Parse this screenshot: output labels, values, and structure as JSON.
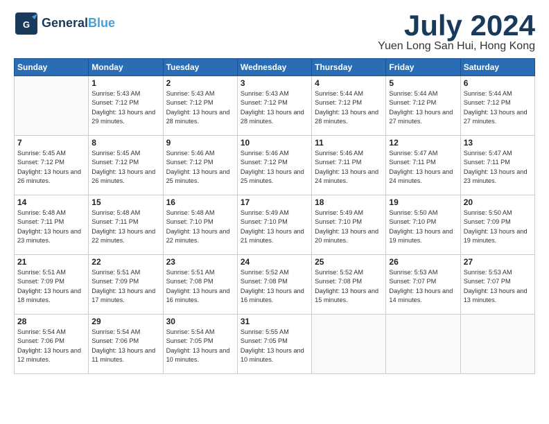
{
  "header": {
    "logo_general": "General",
    "logo_blue": "Blue",
    "month": "July 2024",
    "location": "Yuen Long San Hui, Hong Kong"
  },
  "weekdays": [
    "Sunday",
    "Monday",
    "Tuesday",
    "Wednesday",
    "Thursday",
    "Friday",
    "Saturday"
  ],
  "weeks": [
    [
      {
        "day": "",
        "sunrise": "",
        "sunset": "",
        "daylight": ""
      },
      {
        "day": "1",
        "sunrise": "Sunrise: 5:43 AM",
        "sunset": "Sunset: 7:12 PM",
        "daylight": "Daylight: 13 hours and 29 minutes."
      },
      {
        "day": "2",
        "sunrise": "Sunrise: 5:43 AM",
        "sunset": "Sunset: 7:12 PM",
        "daylight": "Daylight: 13 hours and 28 minutes."
      },
      {
        "day": "3",
        "sunrise": "Sunrise: 5:43 AM",
        "sunset": "Sunset: 7:12 PM",
        "daylight": "Daylight: 13 hours and 28 minutes."
      },
      {
        "day": "4",
        "sunrise": "Sunrise: 5:44 AM",
        "sunset": "Sunset: 7:12 PM",
        "daylight": "Daylight: 13 hours and 28 minutes."
      },
      {
        "day": "5",
        "sunrise": "Sunrise: 5:44 AM",
        "sunset": "Sunset: 7:12 PM",
        "daylight": "Daylight: 13 hours and 27 minutes."
      },
      {
        "day": "6",
        "sunrise": "Sunrise: 5:44 AM",
        "sunset": "Sunset: 7:12 PM",
        "daylight": "Daylight: 13 hours and 27 minutes."
      }
    ],
    [
      {
        "day": "7",
        "sunrise": "Sunrise: 5:45 AM",
        "sunset": "Sunset: 7:12 PM",
        "daylight": "Daylight: 13 hours and 26 minutes."
      },
      {
        "day": "8",
        "sunrise": "Sunrise: 5:45 AM",
        "sunset": "Sunset: 7:12 PM",
        "daylight": "Daylight: 13 hours and 26 minutes."
      },
      {
        "day": "9",
        "sunrise": "Sunrise: 5:46 AM",
        "sunset": "Sunset: 7:12 PM",
        "daylight": "Daylight: 13 hours and 25 minutes."
      },
      {
        "day": "10",
        "sunrise": "Sunrise: 5:46 AM",
        "sunset": "Sunset: 7:12 PM",
        "daylight": "Daylight: 13 hours and 25 minutes."
      },
      {
        "day": "11",
        "sunrise": "Sunrise: 5:46 AM",
        "sunset": "Sunset: 7:11 PM",
        "daylight": "Daylight: 13 hours and 24 minutes."
      },
      {
        "day": "12",
        "sunrise": "Sunrise: 5:47 AM",
        "sunset": "Sunset: 7:11 PM",
        "daylight": "Daylight: 13 hours and 24 minutes."
      },
      {
        "day": "13",
        "sunrise": "Sunrise: 5:47 AM",
        "sunset": "Sunset: 7:11 PM",
        "daylight": "Daylight: 13 hours and 23 minutes."
      }
    ],
    [
      {
        "day": "14",
        "sunrise": "Sunrise: 5:48 AM",
        "sunset": "Sunset: 7:11 PM",
        "daylight": "Daylight: 13 hours and 23 minutes."
      },
      {
        "day": "15",
        "sunrise": "Sunrise: 5:48 AM",
        "sunset": "Sunset: 7:11 PM",
        "daylight": "Daylight: 13 hours and 22 minutes."
      },
      {
        "day": "16",
        "sunrise": "Sunrise: 5:48 AM",
        "sunset": "Sunset: 7:10 PM",
        "daylight": "Daylight: 13 hours and 22 minutes."
      },
      {
        "day": "17",
        "sunrise": "Sunrise: 5:49 AM",
        "sunset": "Sunset: 7:10 PM",
        "daylight": "Daylight: 13 hours and 21 minutes."
      },
      {
        "day": "18",
        "sunrise": "Sunrise: 5:49 AM",
        "sunset": "Sunset: 7:10 PM",
        "daylight": "Daylight: 13 hours and 20 minutes."
      },
      {
        "day": "19",
        "sunrise": "Sunrise: 5:50 AM",
        "sunset": "Sunset: 7:10 PM",
        "daylight": "Daylight: 13 hours and 19 minutes."
      },
      {
        "day": "20",
        "sunrise": "Sunrise: 5:50 AM",
        "sunset": "Sunset: 7:09 PM",
        "daylight": "Daylight: 13 hours and 19 minutes."
      }
    ],
    [
      {
        "day": "21",
        "sunrise": "Sunrise: 5:51 AM",
        "sunset": "Sunset: 7:09 PM",
        "daylight": "Daylight: 13 hours and 18 minutes."
      },
      {
        "day": "22",
        "sunrise": "Sunrise: 5:51 AM",
        "sunset": "Sunset: 7:09 PM",
        "daylight": "Daylight: 13 hours and 17 minutes."
      },
      {
        "day": "23",
        "sunrise": "Sunrise: 5:51 AM",
        "sunset": "Sunset: 7:08 PM",
        "daylight": "Daylight: 13 hours and 16 minutes."
      },
      {
        "day": "24",
        "sunrise": "Sunrise: 5:52 AM",
        "sunset": "Sunset: 7:08 PM",
        "daylight": "Daylight: 13 hours and 16 minutes."
      },
      {
        "day": "25",
        "sunrise": "Sunrise: 5:52 AM",
        "sunset": "Sunset: 7:08 PM",
        "daylight": "Daylight: 13 hours and 15 minutes."
      },
      {
        "day": "26",
        "sunrise": "Sunrise: 5:53 AM",
        "sunset": "Sunset: 7:07 PM",
        "daylight": "Daylight: 13 hours and 14 minutes."
      },
      {
        "day": "27",
        "sunrise": "Sunrise: 5:53 AM",
        "sunset": "Sunset: 7:07 PM",
        "daylight": "Daylight: 13 hours and 13 minutes."
      }
    ],
    [
      {
        "day": "28",
        "sunrise": "Sunrise: 5:54 AM",
        "sunset": "Sunset: 7:06 PM",
        "daylight": "Daylight: 13 hours and 12 minutes."
      },
      {
        "day": "29",
        "sunrise": "Sunrise: 5:54 AM",
        "sunset": "Sunset: 7:06 PM",
        "daylight": "Daylight: 13 hours and 11 minutes."
      },
      {
        "day": "30",
        "sunrise": "Sunrise: 5:54 AM",
        "sunset": "Sunset: 7:05 PM",
        "daylight": "Daylight: 13 hours and 10 minutes."
      },
      {
        "day": "31",
        "sunrise": "Sunrise: 5:55 AM",
        "sunset": "Sunset: 7:05 PM",
        "daylight": "Daylight: 13 hours and 10 minutes."
      },
      {
        "day": "",
        "sunrise": "",
        "sunset": "",
        "daylight": ""
      },
      {
        "day": "",
        "sunrise": "",
        "sunset": "",
        "daylight": ""
      },
      {
        "day": "",
        "sunrise": "",
        "sunset": "",
        "daylight": ""
      }
    ]
  ]
}
